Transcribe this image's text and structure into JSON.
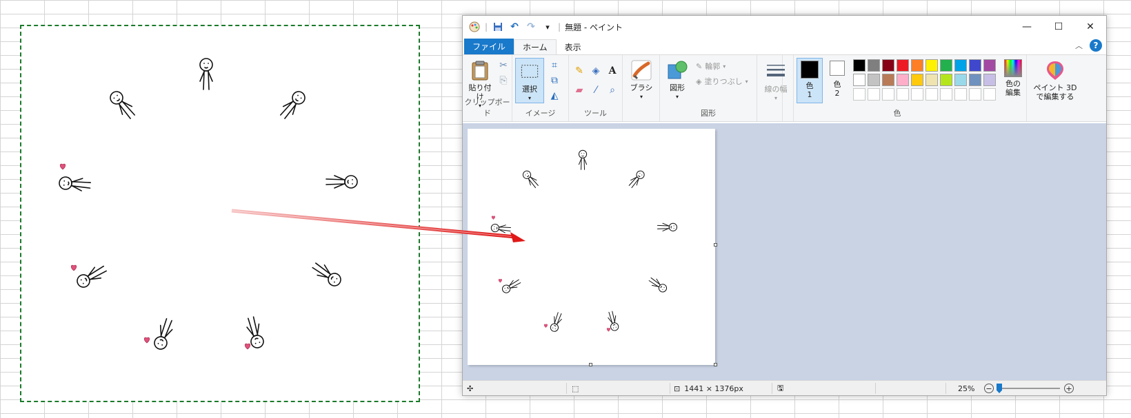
{
  "window": {
    "title": "無題 - ペイント",
    "minimize": "—",
    "maximize": "☐",
    "close": "✕"
  },
  "qat": {
    "save": "save-icon",
    "undo": "undo-icon",
    "redo": "redo-icon",
    "customize": "▾"
  },
  "tabs": [
    {
      "label": "ファイル"
    },
    {
      "label": "ホーム"
    },
    {
      "label": "表示"
    }
  ],
  "ribbon": {
    "clipboard": {
      "paste_label": "貼り付け",
      "group_label": "クリップボード"
    },
    "image": {
      "select_label": "選択",
      "group_label": "イメージ"
    },
    "tools": {
      "group_label": "ツール"
    },
    "brush": {
      "label": "ブラシ"
    },
    "shapes": {
      "shape_label": "図形",
      "outline_label": "輪郭",
      "fill_label": "塗りつぶし",
      "group_label": "図形"
    },
    "size": {
      "label": "線の幅"
    },
    "colors": {
      "color1_label": "色",
      "color1_num": "1",
      "color2_label": "色",
      "color2_num": "2",
      "edit_label_1": "色の",
      "edit_label_2": "編集",
      "group_label": "色",
      "color1_value": "#000000",
      "color2_value": "#ffffff",
      "palette_row1": [
        "#000000",
        "#7f7f7f",
        "#880015",
        "#ed1c24",
        "#ff7f27",
        "#fff200",
        "#22b14c",
        "#00a2e8",
        "#3f48cc",
        "#a349a4"
      ],
      "palette_row2": [
        "#ffffff",
        "#c3c3c3",
        "#b97a57",
        "#ffaec9",
        "#ffc90e",
        "#efe4b0",
        "#b5e61d",
        "#99d9ea",
        "#7092be",
        "#c8bfe7"
      ]
    },
    "paint3d": {
      "label_1": "ペイント 3D",
      "label_2": "で編集する"
    }
  },
  "status": {
    "image_size": "1441 × 1376px",
    "zoom": "25%",
    "zoom_minus": "−",
    "zoom_plus": "+",
    "zoom_level": 0.25
  }
}
